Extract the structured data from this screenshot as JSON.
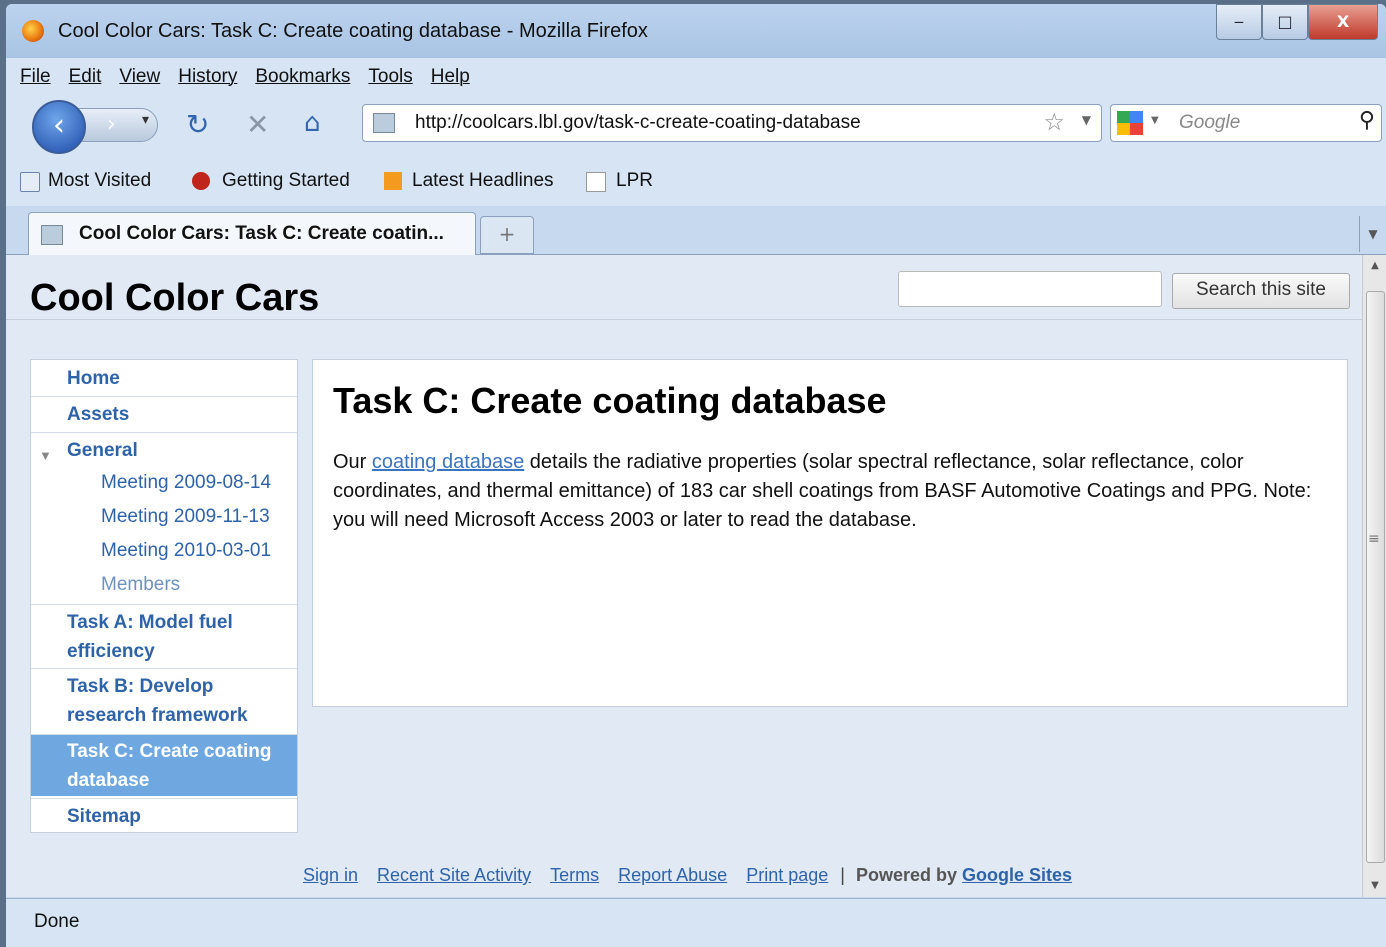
{
  "window": {
    "title": "Cool Color Cars: Task C: Create coating database - Mozilla Firefox",
    "min_label": "‒",
    "max_label": "□",
    "close_label": "X"
  },
  "menu": [
    "File",
    "Edit",
    "View",
    "History",
    "Bookmarks",
    "Tools",
    "Help"
  ],
  "toolbar": {
    "url": "http://coolcars.lbl.gov/task-c-create-coating-database",
    "search_placeholder": "Google"
  },
  "bookmarks": [
    "Most Visited",
    "Getting Started",
    "Latest Headlines",
    "LPR"
  ],
  "tab": {
    "title": "Cool Color Cars: Task C: Create coatin...",
    "new_tab": "+"
  },
  "site": {
    "title": "Cool Color Cars",
    "search_button": "Search this site"
  },
  "sidebar": {
    "home": "Home",
    "assets": "Assets",
    "general": "General",
    "meeting1": "Meeting 2009-08-14",
    "meeting2": "Meeting 2009-11-13",
    "meeting3": "Meeting 2010-03-01",
    "members": "Members",
    "taskA_1": "Task A: Model fuel",
    "taskA_2": "efficiency",
    "taskB_1": "Task B: Develop",
    "taskB_2": "research framework",
    "taskC_1": "Task C: Create coating",
    "taskC_2": "database",
    "sitemap": "Sitemap"
  },
  "main": {
    "heading": "Task C: Create coating database",
    "para_pre": "Our ",
    "para_link": "coating database",
    "para_post": " details the radiative properties (solar spectral reflectance, solar reflectance, color coordinates, and thermal emittance) of 183 car shell coatings from BASF Automotive Coatings and PPG. Note: you will need Microsoft Access 2003 or later to read the database."
  },
  "footer": {
    "sign_in": "Sign in",
    "recent": "Recent Site Activity",
    "terms": "Terms",
    "report": "Report Abuse",
    "print": "Print page",
    "sep": "|",
    "powered": "Powered by",
    "google_sites": "Google Sites"
  },
  "status": "Done"
}
